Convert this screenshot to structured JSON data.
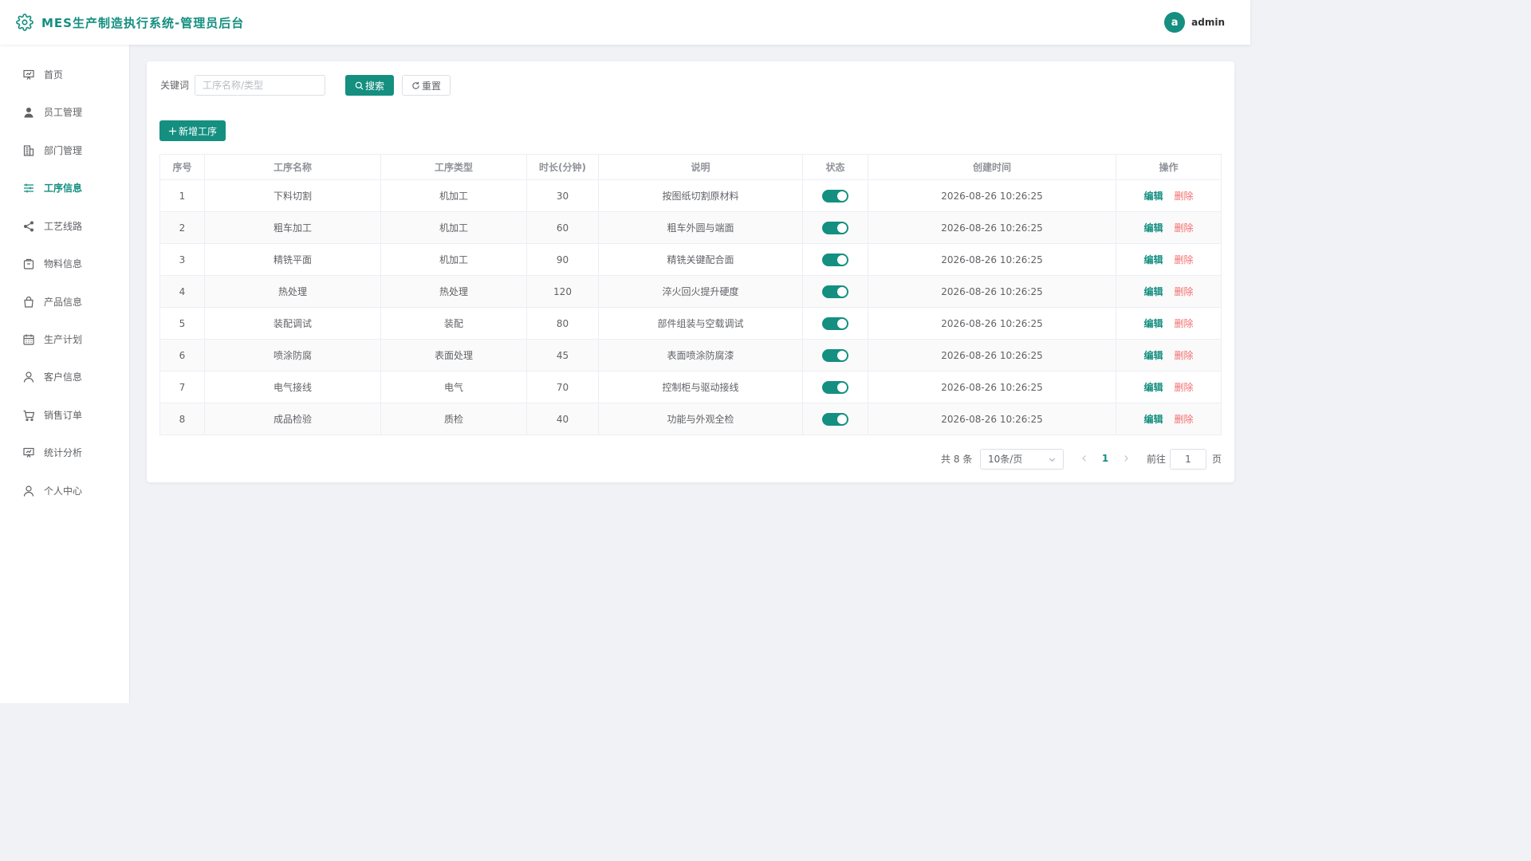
{
  "app": {
    "title": "MES生产制造执行系统-管理员后台"
  },
  "user": {
    "avatar_letter": "a",
    "name": "admin"
  },
  "sidebar": {
    "items": [
      {
        "label": "首页",
        "icon": "chart-board-icon"
      },
      {
        "label": "员工管理",
        "icon": "user-filled-icon"
      },
      {
        "label": "部门管理",
        "icon": "building-icon"
      },
      {
        "label": "工序信息",
        "icon": "sliders-icon",
        "active": true
      },
      {
        "label": "工艺线路",
        "icon": "share-icon"
      },
      {
        "label": "物料信息",
        "icon": "box-icon"
      },
      {
        "label": "产品信息",
        "icon": "shopping-bag-icon"
      },
      {
        "label": "生产计划",
        "icon": "calendar-icon"
      },
      {
        "label": "客户信息",
        "icon": "user-icon"
      },
      {
        "label": "销售订单",
        "icon": "shopping-cart-icon"
      },
      {
        "label": "统计分析",
        "icon": "chart-board-icon"
      },
      {
        "label": "个人中心",
        "icon": "user-icon"
      }
    ]
  },
  "search": {
    "label": "关键词",
    "placeholder": "工序名称/类型",
    "value": "",
    "search_label": "搜索",
    "reset_label": "重置"
  },
  "toolbar": {
    "add_label": "新增工序"
  },
  "table": {
    "headers": [
      "序号",
      "工序名称",
      "工序类型",
      "时长(分钟)",
      "说明",
      "状态",
      "创建时间",
      "操作"
    ],
    "rows": [
      {
        "no": "1",
        "name": "下料切割",
        "type": "机加工",
        "duration": "30",
        "desc": "按图纸切割原材料",
        "enabled": true,
        "created": "2026-08-26 10:26:25"
      },
      {
        "no": "2",
        "name": "粗车加工",
        "type": "机加工",
        "duration": "60",
        "desc": "粗车外圆与端面",
        "enabled": true,
        "created": "2026-08-26 10:26:25"
      },
      {
        "no": "3",
        "name": "精铣平面",
        "type": "机加工",
        "duration": "90",
        "desc": "精铣关键配合面",
        "enabled": true,
        "created": "2026-08-26 10:26:25"
      },
      {
        "no": "4",
        "name": "热处理",
        "type": "热处理",
        "duration": "120",
        "desc": "淬火回火提升硬度",
        "enabled": true,
        "created": "2026-08-26 10:26:25"
      },
      {
        "no": "5",
        "name": "装配调试",
        "type": "装配",
        "duration": "80",
        "desc": "部件组装与空载调试",
        "enabled": true,
        "created": "2026-08-26 10:26:25"
      },
      {
        "no": "6",
        "name": "喷涂防腐",
        "type": "表面处理",
        "duration": "45",
        "desc": "表面喷涂防腐漆",
        "enabled": true,
        "created": "2026-08-26 10:26:25"
      },
      {
        "no": "7",
        "name": "电气接线",
        "type": "电气",
        "duration": "70",
        "desc": "控制柜与驱动接线",
        "enabled": true,
        "created": "2026-08-26 10:26:25"
      },
      {
        "no": "8",
        "name": "成品检验",
        "type": "质检",
        "duration": "40",
        "desc": "功能与外观全检",
        "enabled": true,
        "created": "2026-08-26 10:26:25"
      }
    ],
    "edit_label": "编辑",
    "delete_label": "删除"
  },
  "pagination": {
    "total_text": "共 8 条",
    "page_size": "10条/页",
    "current_page": "1",
    "goto_label": "前往",
    "goto_value": "1",
    "page_unit": "页"
  },
  "colors": {
    "accent": "#148f80",
    "danger": "#f56c6c"
  }
}
